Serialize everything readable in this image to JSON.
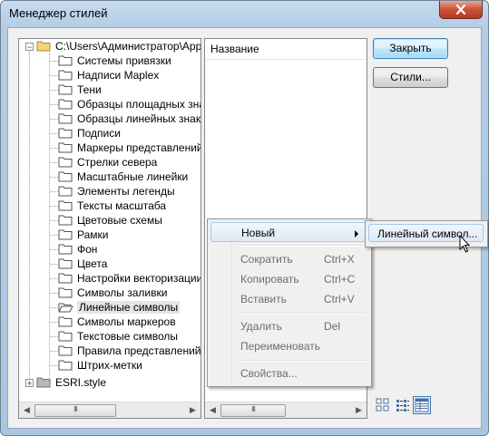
{
  "window": {
    "title": "Менеджер стилей"
  },
  "tree": {
    "root_label": "C:\\Users\\Администратор\\AppD",
    "items": [
      "Системы привязки",
      "Надписи Maplex",
      "Тени",
      "Образцы площадных знако",
      "Образцы линейных знаков",
      "Подписи",
      "Маркеры представлений",
      "Стрелки севера",
      "Масштабные линейки",
      "Элементы легенды",
      "Тексты масштаба",
      "Цветовые схемы",
      "Рамки",
      "Фон",
      "Цвета",
      "Настройки векторизации",
      "Символы заливки",
      "Линейные символы",
      "Символы маркеров",
      "Текстовые символы",
      "Правила представлений",
      "Штрих-метки"
    ],
    "selected_item": "Линейные символы",
    "style_label": "ESRI.style",
    "thumb_grip": "III"
  },
  "list": {
    "column_header": "Название",
    "thumb_grip": "III"
  },
  "buttons": {
    "close": "Закрыть",
    "styles": "Стили..."
  },
  "context_menu": {
    "new": "Новый",
    "cut": "Сократить",
    "cut_shortcut": "Ctrl+X",
    "copy": "Копировать",
    "copy_shortcut": "Ctrl+C",
    "paste": "Вставить",
    "paste_shortcut": "Ctrl+V",
    "delete": "Удалить",
    "delete_shortcut": "Del",
    "rename": "Переименовать",
    "properties": "Свойства..."
  },
  "submenu": {
    "line_symbol": "Линейный символ..."
  },
  "icons": [
    "close-icon",
    "folder-icon",
    "open-folder-icon",
    "style-file-icon",
    "large-icons-view-icon",
    "list-view-icon",
    "details-view-icon",
    "mouse-cursor-icon"
  ]
}
